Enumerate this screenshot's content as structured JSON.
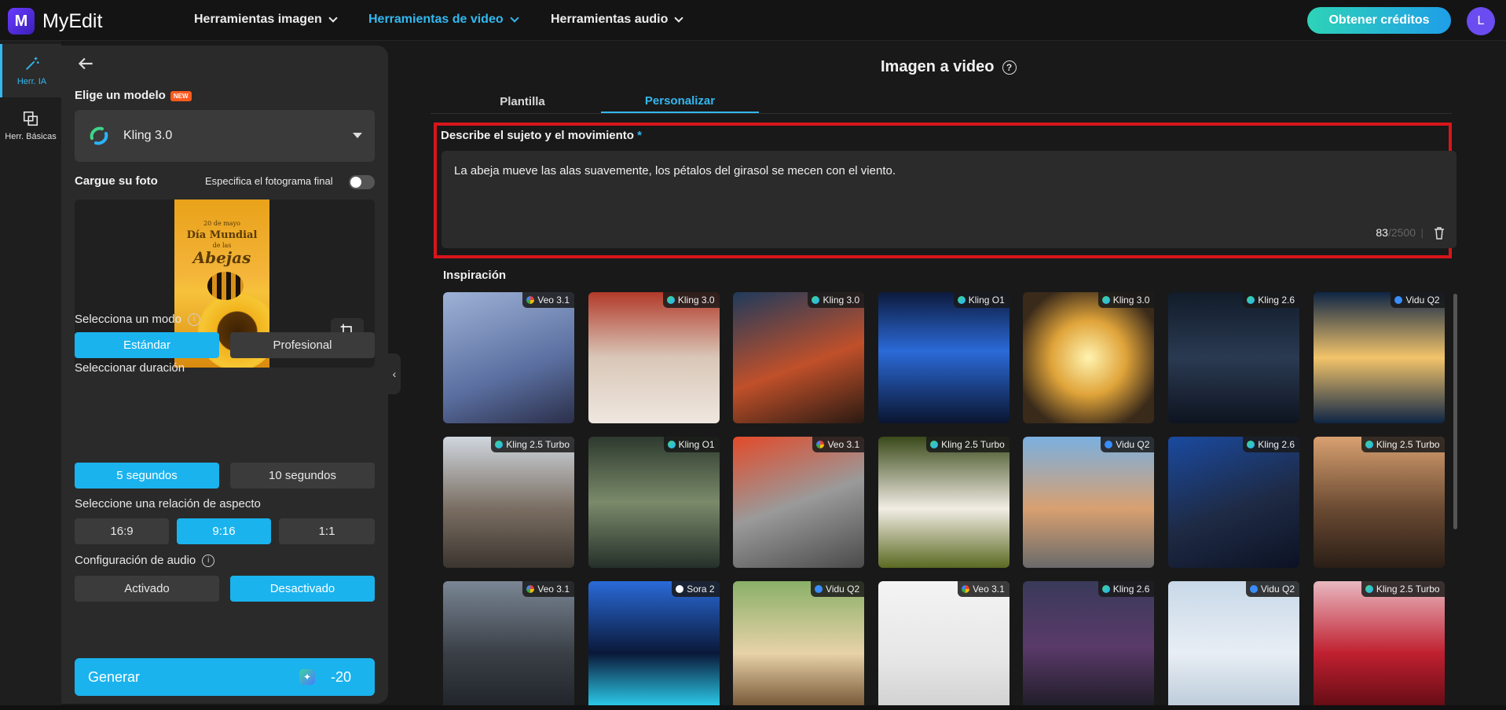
{
  "app": {
    "name": "MyEdit",
    "logo_letter": "M"
  },
  "nav": [
    {
      "label": "Herramientas imagen",
      "active": false
    },
    {
      "label": "Herramientas de video",
      "active": true
    },
    {
      "label": "Herramientas audio",
      "active": false
    }
  ],
  "header": {
    "credits_button": "Obtener créditos",
    "avatar_initial": "L"
  },
  "rail": [
    {
      "label": "Herr. IA",
      "icon": "magic-wand-icon",
      "active": true
    },
    {
      "label": "Herr. Básicas",
      "icon": "layers-icon",
      "active": false
    }
  ],
  "panel": {
    "model_title": "Elige un modelo",
    "new_badge": "NEW",
    "model_selected": "Kling 3.0",
    "upload_title": "Cargue su foto",
    "final_frame_label": "Especifica el fotograma final",
    "final_frame_on": false,
    "poster": {
      "date": "20 de mayo",
      "line1": "Día Mundial",
      "line2": "de las",
      "line3": "Abejas"
    },
    "mode_label": "Selecciona un modo",
    "modes": [
      "Estándar",
      "Profesional"
    ],
    "mode_selected": "Estándar",
    "duration_label": "Seleccionar duración",
    "durations": [
      "5 segundos",
      "10 segundos"
    ],
    "duration_selected": "5 segundos",
    "aspect_label": "Seleccione una relación de aspecto",
    "aspects": [
      "16:9",
      "9:16",
      "1:1"
    ],
    "aspect_selected": "9:16",
    "audio_label": "Configuración de audio",
    "audio_options": [
      "Activado",
      "Desactivado"
    ],
    "audio_selected": "Desactivado",
    "generate_label": "Generar",
    "generate_cost": "-20"
  },
  "main": {
    "title": "Imagen a video",
    "tabs": [
      {
        "label": "Plantilla",
        "active": false
      },
      {
        "label": "Personalizar",
        "active": true
      }
    ],
    "prompt_label": "Describe el sujeto y el movimiento",
    "prompt_required_mark": "*",
    "prompt_text": "La abeja mueve las alas suavemente, los pétalos del girasol se mecen con el viento.",
    "char_count": "83",
    "char_max": "/2500",
    "inspiration_title": "Inspiración",
    "cards": [
      {
        "model": "Veo 3.1",
        "brand": "google",
        "bg": "linear-gradient(160deg,#9eb2d6,#5a6fa0 60%,#2b2f4a)"
      },
      {
        "model": "Kling 3.0",
        "brand": "kling",
        "bg": "linear-gradient(180deg,#b23a2a,#d9c7b8 50%,#efe7df)"
      },
      {
        "model": "Kling 3.0",
        "brand": "kling",
        "bg": "linear-gradient(160deg,#1f3a5c,#c0502a 55%,#2a1a12)"
      },
      {
        "model": "Kling O1",
        "brand": "kling",
        "bg": "linear-gradient(180deg,#0d1a3d,#2b6ad8 45%,#0a1530)"
      },
      {
        "model": "Kling 3.0",
        "brand": "kling",
        "bg": "radial-gradient(circle,#fff3b0,#e0a43a 40%,#3a2a1a 80%)"
      },
      {
        "model": "Kling 2.6",
        "brand": "kling",
        "bg": "linear-gradient(180deg,#121c2a,#2a3a52 50%,#0e1420)"
      },
      {
        "model": "Vidu Q2",
        "brand": "vidu",
        "bg": "linear-gradient(180deg,#0e2545,#f3c46a 50%,#0e2545)"
      },
      {
        "model": "Kling 2.5 Turbo",
        "brand": "kling",
        "bg": "linear-gradient(180deg,#cfd6de,#7a6e62 55%,#3b352f)"
      },
      {
        "model": "Kling O1",
        "brand": "kling",
        "bg": "linear-gradient(180deg,#2d3a2e,#7a8a6a 50%,#25302a)"
      },
      {
        "model": "Veo 3.1",
        "brand": "google",
        "bg": "linear-gradient(160deg,#e24a2a,#9a9a9a 50%,#4a4a4a)"
      },
      {
        "model": "Kling 2.5 Turbo",
        "brand": "kling",
        "bg": "linear-gradient(180deg,#3a4a1a,#f2ede4 55%,#5a6a22)"
      },
      {
        "model": "Vidu Q2",
        "brand": "vidu",
        "bg": "linear-gradient(180deg,#7ab0e0,#d8a070 55%,#6a6a6a)"
      },
      {
        "model": "Kling 2.6",
        "brand": "kling",
        "bg": "linear-gradient(160deg,#1a4aa0,#1e2a44 55%,#0c1224)"
      },
      {
        "model": "Kling 2.5 Turbo",
        "brand": "kling",
        "bg": "linear-gradient(180deg,#d8a070,#6a4a32 55%,#2a1e16)"
      },
      {
        "model": "Veo 3.1",
        "brand": "google",
        "bg": "linear-gradient(180deg,#7a8694,#3a3f46 55%,#1e2228)"
      },
      {
        "model": "Sora 2",
        "brand": "sora",
        "bg": "linear-gradient(180deg,#2a6ad8,#0a1838 55%,#30e0ff)"
      },
      {
        "model": "Vidu Q2",
        "brand": "vidu",
        "bg": "linear-gradient(180deg,#8ab068,#e8d2a8 55%,#6a4a2a)"
      },
      {
        "model": "Veo 3.1",
        "brand": "google",
        "bg": "linear-gradient(180deg,#f4f4f4,#e6e6e6 60%,#cfcfcf)"
      },
      {
        "model": "Kling 2.6",
        "brand": "kling",
        "bg": "linear-gradient(180deg,#3a3a5a,#5a3a6a 50%,#1a1a22)"
      },
      {
        "model": "Vidu Q2",
        "brand": "vidu",
        "bg": "linear-gradient(180deg,#c8d8e8,#e8eef4 55%,#b8c8d8)"
      },
      {
        "model": "Kling 2.5 Turbo",
        "brand": "kling",
        "bg": "linear-gradient(180deg,#e8b8c0,#c02030 55%,#5a0a12)"
      }
    ]
  },
  "colors": {
    "accent": "#1ab3ee",
    "highlight_border": "#d7151b",
    "credits_gradient_from": "#2ed3b7",
    "credits_gradient_to": "#1f9ee8"
  }
}
